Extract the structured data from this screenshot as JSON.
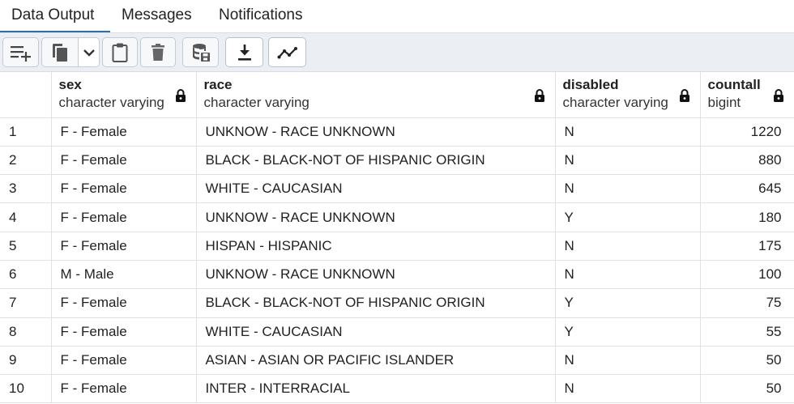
{
  "tabs": [
    "Data Output",
    "Messages",
    "Notifications"
  ],
  "toolbar": {
    "buttons": [
      {
        "name": "add-row-button",
        "icon": "add-row-icon"
      },
      {
        "name": "copy-button",
        "icon": "copy-icon"
      },
      {
        "name": "copy-dropdown-button",
        "icon": "chevron-down-icon"
      },
      {
        "name": "paste-button",
        "icon": "clipboard-icon"
      },
      {
        "name": "delete-button",
        "icon": "trash-icon"
      },
      {
        "name": "save-data-button",
        "icon": "database-save-icon"
      },
      {
        "name": "download-button",
        "icon": "download-icon"
      },
      {
        "name": "graph-button",
        "icon": "line-graph-icon"
      }
    ]
  },
  "columns": [
    {
      "name": "sex",
      "type": "character varying"
    },
    {
      "name": "race",
      "type": "character varying"
    },
    {
      "name": "disabled",
      "type": "character varying"
    },
    {
      "name": "countall",
      "type": "bigint"
    }
  ],
  "rows": [
    [
      "1",
      "F - Female",
      "UNKNOW - RACE UNKNOWN",
      "N",
      "1220"
    ],
    [
      "2",
      "F - Female",
      "BLACK - BLACK-NOT OF HISPANIC ORIGIN",
      "N",
      "880"
    ],
    [
      "3",
      "F - Female",
      "WHITE - CAUCASIAN",
      "N",
      "645"
    ],
    [
      "4",
      "F - Female",
      "UNKNOW - RACE UNKNOWN",
      "Y",
      "180"
    ],
    [
      "5",
      "F - Female",
      "HISPAN - HISPANIC",
      "N",
      "175"
    ],
    [
      "6",
      "M - Male",
      "UNKNOW - RACE UNKNOWN",
      "N",
      "100"
    ],
    [
      "7",
      "F - Female",
      "BLACK - BLACK-NOT OF HISPANIC ORIGIN",
      "Y",
      "75"
    ],
    [
      "8",
      "F - Female",
      "WHITE - CAUCASIAN",
      "Y",
      "55"
    ],
    [
      "9",
      "F - Female",
      "ASIAN - ASIAN OR PACIFIC ISLANDER",
      "N",
      "50"
    ],
    [
      "10",
      "F - Female",
      "INTER - INTERRACIAL",
      "N",
      "50"
    ]
  ],
  "colors": {
    "accent": "#2b6ea8",
    "toolbar_bg": "#ebeff4",
    "grid_border": "#dde2e8"
  }
}
